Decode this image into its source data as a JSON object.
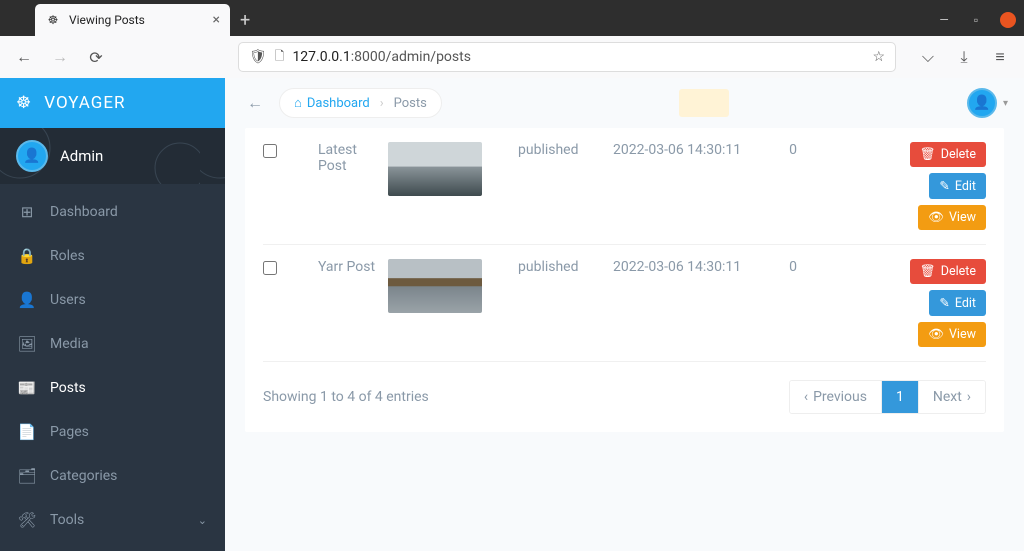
{
  "tab": {
    "title": "Viewing Posts"
  },
  "url": {
    "prefix": "127.0.0.1",
    "rest": ":8000/admin/posts"
  },
  "brand": "VOYAGER",
  "user": "Admin",
  "menu": [
    {
      "label": "Dashboard",
      "icon": "⊞",
      "active": false
    },
    {
      "label": "Roles",
      "icon": "🔒",
      "active": false
    },
    {
      "label": "Users",
      "icon": "👤",
      "active": false
    },
    {
      "label": "Media",
      "icon": "🖼",
      "active": false
    },
    {
      "label": "Posts",
      "icon": "📰",
      "active": true
    },
    {
      "label": "Pages",
      "icon": "📄",
      "active": false
    },
    {
      "label": "Categories",
      "icon": "🗂",
      "active": false
    },
    {
      "label": "Tools",
      "icon": "🛠",
      "active": false,
      "chev": true
    }
  ],
  "breadcrumb": {
    "dash": "Dashboard",
    "cur": "Posts"
  },
  "rows": [
    {
      "title": "Latest Post",
      "status": "published",
      "date": "2022-03-06 14:30:11",
      "num": "0",
      "thumb": "ocean"
    },
    {
      "title": "Yarr Post",
      "status": "published",
      "date": "2022-03-06 14:30:11",
      "num": "0",
      "thumb": "boat"
    }
  ],
  "actions": {
    "delete": "Delete",
    "edit": "Edit",
    "view": "View"
  },
  "showing": "Showing 1 to 4 of 4 entries",
  "pager": {
    "prev": "Previous",
    "page": "1",
    "next": "Next"
  }
}
